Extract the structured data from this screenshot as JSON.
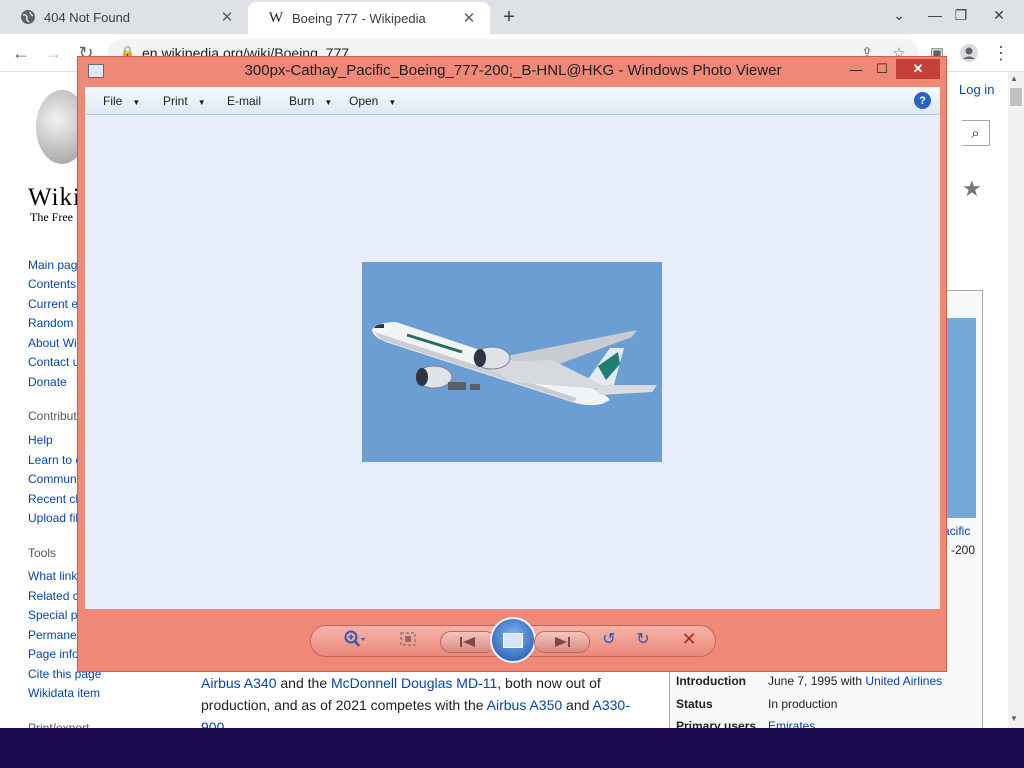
{
  "browser": {
    "tabs": [
      {
        "title": "404 Not Found",
        "icon": "globe-icon"
      },
      {
        "title": "Boeing 777 - Wikipedia",
        "icon": "wikipedia-w-icon"
      }
    ],
    "url": "en.wikipedia.org/wiki/Boeing_777"
  },
  "wiki": {
    "logo_word": "Wiki",
    "logo_sub": "The Free",
    "login": "Log in",
    "nav": [
      "Main page",
      "Contents",
      "Current e",
      "Random",
      "About Wi",
      "Contact u",
      "Donate"
    ],
    "contribute_heading": "Contribut",
    "contribute": [
      "Help",
      "Learn to e",
      "Commun",
      "Recent ch",
      "Upload fil"
    ],
    "tools_heading": "Tools",
    "tools": [
      "What link",
      "Related c",
      "Special p",
      "Permane",
      "Page info",
      "Cite this page",
      "Wikidata item"
    ],
    "print_heading": "Print/export",
    "infobox": {
      "caption_line1": "acific",
      "caption_line2": "-200",
      "rows": [
        {
          "key": "Introduction",
          "value": "June 7, 1995 with ",
          "link": "United Airlines"
        },
        {
          "key": "Status",
          "value": "In production",
          "link": ""
        },
        {
          "key": "Primary users",
          "value": "",
          "link": "Emirates"
        }
      ]
    },
    "body": {
      "line1_link1": "Airbus A340",
      "line1_mid": " and the ",
      "line1_link2": "McDonnell Douglas MD-11",
      "line1_end": ", both now out of",
      "line2_start": "production, and as of 2021 competes with the ",
      "line2_link1": "Airbus A350",
      "line2_mid": " and ",
      "line2_link2": "A330-",
      "line3": "900"
    }
  },
  "photo_viewer": {
    "title": "300px-Cathay_Pacific_Boeing_777-200;_B-HNL@HKG - Windows Photo Viewer",
    "menu": [
      {
        "label": "File",
        "has_arrow": true
      },
      {
        "label": "Print",
        "has_arrow": true
      },
      {
        "label": "E-mail",
        "has_arrow": false
      },
      {
        "label": "Burn",
        "has_arrow": true
      },
      {
        "label": "Open",
        "has_arrow": true
      }
    ],
    "help": "?",
    "controls": [
      "zoom-icon",
      "actual-size-icon",
      "previous-icon",
      "slideshow-icon",
      "next-icon",
      "rotate-left-icon",
      "rotate-right-icon",
      "delete-icon"
    ],
    "colors": {
      "frame": "#f08878",
      "canvas": "#e8eef9",
      "sky": "#6b9fd4",
      "taskbar": "#1c0a4e"
    }
  }
}
